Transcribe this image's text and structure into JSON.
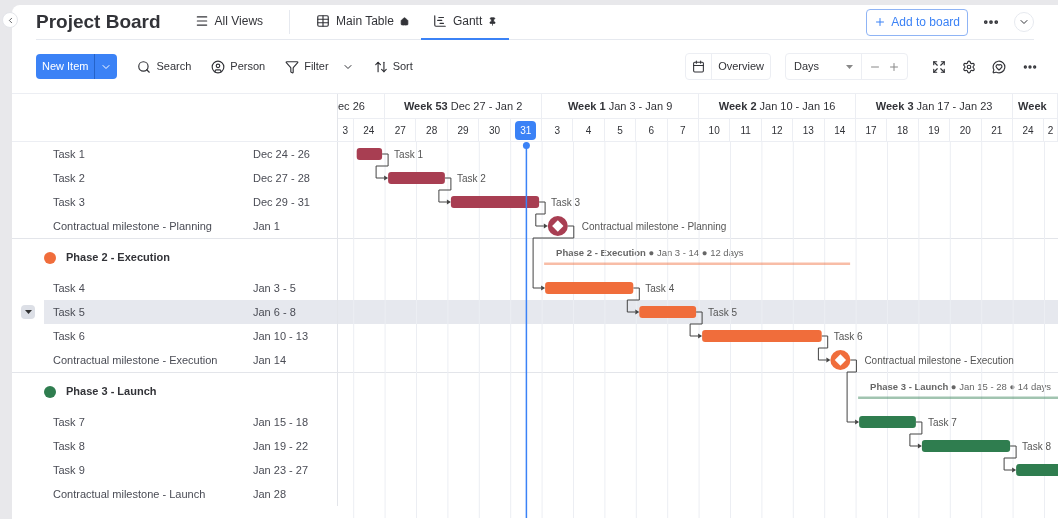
{
  "board": {
    "title": "Project Board"
  },
  "views": [
    {
      "label": "All Views",
      "kind": "menu",
      "selected": false
    },
    {
      "label": "Main Table",
      "kind": "table",
      "selected": false
    },
    {
      "label": "Gantt",
      "kind": "gantt",
      "selected": true
    }
  ],
  "add_button": "Add to board",
  "toolbar": {
    "new_item": "New Item",
    "tools": [
      {
        "label": "Search",
        "kind": "search"
      },
      {
        "label": "Person",
        "kind": "person"
      },
      {
        "label": "Filter",
        "kind": "filter"
      },
      {
        "label": "Sort",
        "kind": "sort"
      }
    ],
    "overview": "Overview",
    "scale": "Days"
  },
  "timeline": {
    "weeks": [
      {
        "range": "ec 26"
      },
      {
        "week": "Week 53",
        "range": "Dec 27 - Jan 2"
      },
      {
        "week": "Week 1",
        "range": "Jan 3 - Jan 9"
      },
      {
        "week": "Week 2",
        "range": "Jan 10 - Jan 16"
      },
      {
        "week": "Week 3",
        "range": "Jan 17 - Jan 23"
      },
      {
        "week": "Week"
      }
    ],
    "days": [
      {
        "label": "3",
        "today": false
      },
      {
        "label": "24",
        "today": false
      },
      {
        "label": "27",
        "today": false
      },
      {
        "label": "28",
        "today": false
      },
      {
        "label": "29",
        "today": false
      },
      {
        "label": "30",
        "today": false
      },
      {
        "label": "31",
        "today": true
      },
      {
        "label": "3",
        "today": false
      },
      {
        "label": "4",
        "today": false
      },
      {
        "label": "5",
        "today": false
      },
      {
        "label": "6",
        "today": false
      },
      {
        "label": "7",
        "today": false
      },
      {
        "label": "10",
        "today": false
      },
      {
        "label": "11",
        "today": false
      },
      {
        "label": "12",
        "today": false
      },
      {
        "label": "13",
        "today": false
      },
      {
        "label": "14",
        "today": false
      },
      {
        "label": "17",
        "today": false
      },
      {
        "label": "18",
        "today": false
      },
      {
        "label": "19",
        "today": false
      },
      {
        "label": "20",
        "today": false
      },
      {
        "label": "21",
        "today": false
      },
      {
        "label": "24",
        "today": false
      },
      {
        "label": "2",
        "today": false
      }
    ]
  },
  "groups": [
    {
      "color": "#a83e52",
      "items": [
        {
          "name": "Task 1",
          "dates": "Dec 24 - 26",
          "kind": "task",
          "selected": false,
          "bar_label": "Task 1"
        },
        {
          "name": "Task 2",
          "dates": "Dec 27 - 28",
          "kind": "task",
          "selected": false,
          "bar_label": "Task 2"
        },
        {
          "name": "Task 3",
          "dates": "Dec 29 - 31",
          "kind": "task",
          "selected": false,
          "bar_label": "Task 3"
        },
        {
          "name": "Contractual milestone - Planning",
          "dates": "Jan 1",
          "kind": "milestone",
          "selected": false,
          "bar_label": "Contractual milestone - Planning"
        }
      ]
    },
    {
      "name": "Phase 2 - Execution",
      "color": "#f06d3b",
      "summary": "**Phase 2 - Execution** ● Jan 3 - 14 ● 12 days",
      "items": [
        {
          "name": "Task 4",
          "dates": "Jan 3 - 5",
          "kind": "task",
          "selected": false,
          "bar_label": "Task 4"
        },
        {
          "name": "Task 5",
          "dates": "Jan 6 - 8",
          "kind": "task",
          "selected": true,
          "bar_label": "Task 5"
        },
        {
          "name": "Task 6",
          "dates": "Jan 10 - 13",
          "kind": "task",
          "selected": false,
          "bar_label": "Task 6"
        },
        {
          "name": "Contractual milestone - Execution",
          "dates": "Jan 14",
          "kind": "milestone",
          "selected": false,
          "bar_label": "Contractual milestone - Execution"
        }
      ]
    },
    {
      "name": "Phase 3 - Launch",
      "color": "#2f7d4f",
      "summary": "**Phase 3 - Launch** ● Jan 15 - 28 ● 14 days",
      "items": [
        {
          "name": "Task 7",
          "dates": "Jan 15 - 18",
          "kind": "task",
          "selected": false,
          "bar_label": "Task 7"
        },
        {
          "name": "Task 8",
          "dates": "Jan 19 - 22",
          "kind": "task",
          "selected": false,
          "bar_label": "Task 8"
        },
        {
          "name": "Task 9",
          "dates": "Jan 23 - 27",
          "kind": "task",
          "selected": false
        },
        {
          "name": "Contractual milestone - Launch",
          "dates": "Jan 28",
          "kind": "milestone",
          "selected": false
        }
      ]
    }
  ]
}
